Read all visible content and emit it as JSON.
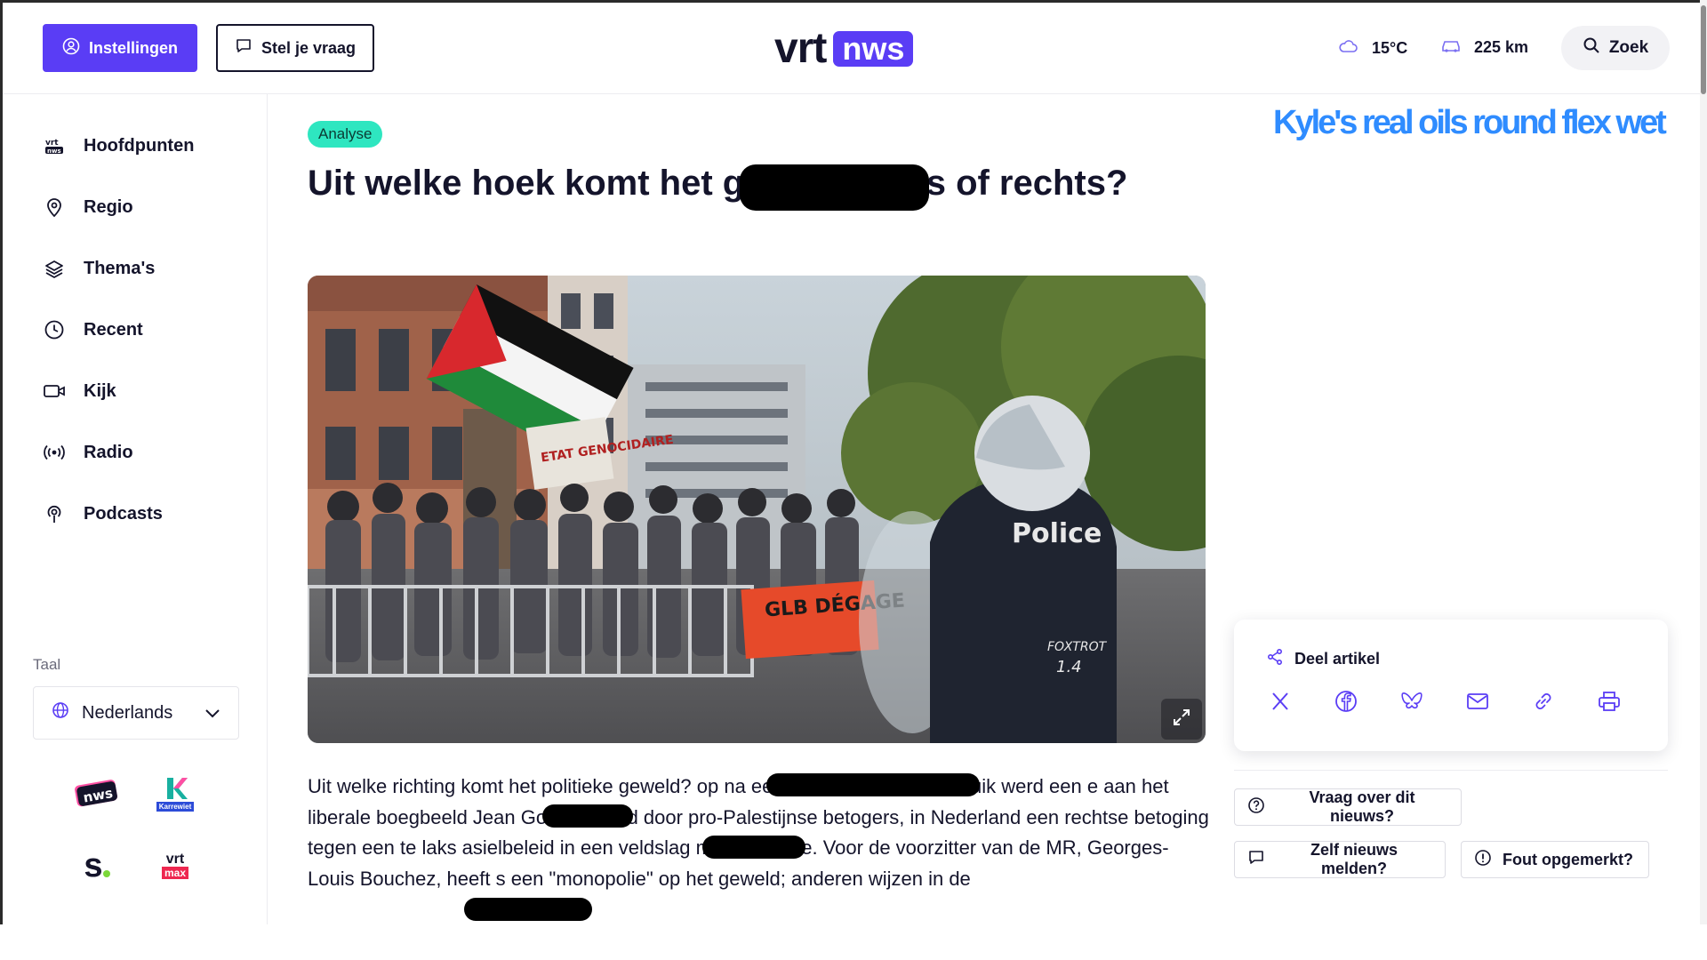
{
  "header": {
    "settings_label": "Instellingen",
    "ask_label": "Stel je vraag",
    "logo_vrt": "vrt",
    "logo_nws": "nws",
    "temperature": "15°C",
    "traffic": "225 km",
    "search_label": "Zoek"
  },
  "sidebar": {
    "items": [
      {
        "label": "Hoofdpunten",
        "icon": "vrt-nws-icon"
      },
      {
        "label": "Regio",
        "icon": "map-pin-icon"
      },
      {
        "label": "Thema's",
        "icon": "layers-icon"
      },
      {
        "label": "Recent",
        "icon": "clock-icon"
      },
      {
        "label": "Kijk",
        "icon": "video-icon"
      },
      {
        "label": "Radio",
        "icon": "radio-icon"
      },
      {
        "label": "Podcasts",
        "icon": "podcast-icon"
      }
    ],
    "language_label": "Taal",
    "language_value": "Nederlands",
    "brands": {
      "nws": "nws",
      "karrewiet": "Karrewiet",
      "sporza": "s",
      "vrtmax_top": "vrt",
      "vrtmax_bottom": "max"
    }
  },
  "article": {
    "tag": "Analyse",
    "title": "Uit welke hoek komt het                geweld: links of rechts?",
    "image_texts": {
      "banner": "GLB DÉGAGE",
      "police": "Police",
      "foxtrot": "FOXTROT",
      "number": "1.4",
      "sign": "ETAT GENOCIDAIRE"
    },
    "body": "Uit welke richting komt het politieke geweld?                        op na een turbulente week. In Luik werd een                e aan het liberale boegbeeld Jean Gol verstoord door pro-Palestijnse betogers, in Nederland                een rechtse betoging tegen een te laks asielbeleid in een veldslag met de politie. Voor de voorzitter van de MR, Georges-Louis Bouchez, heeft                s een \"monopolie\" op het geweld; anderen wijzen in de"
  },
  "promo_text": "Kyle's real oils round flex wet",
  "share": {
    "title": "Deel artikel",
    "icons": [
      "x-icon",
      "facebook-icon",
      "bluesky-icon",
      "mail-icon",
      "link-icon",
      "print-icon"
    ]
  },
  "actions": {
    "question": "Vraag over dit nieuws?",
    "report": "Zelf nieuws melden?",
    "error": "Fout opgemerkt?"
  },
  "colors": {
    "accent": "#5a3df5",
    "tag": "#2ee6c0",
    "promo": "#2f8cff",
    "text": "#14142b"
  }
}
